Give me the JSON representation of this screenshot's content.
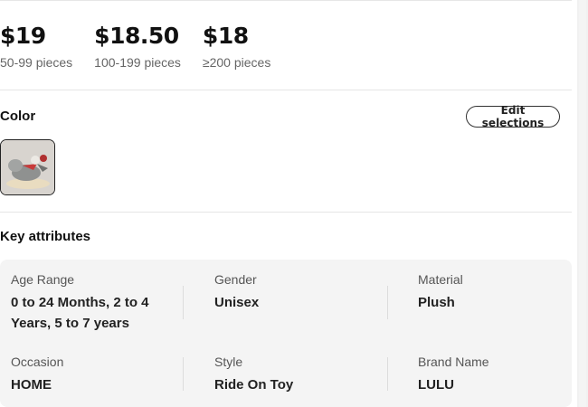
{
  "pricing": {
    "tiers": [
      {
        "price": "$19",
        "range": "50-99 pieces"
      },
      {
        "price": "$18.50",
        "range": "100-199 pieces"
      },
      {
        "price": "$18",
        "range": "≥200 pieces"
      }
    ]
  },
  "color": {
    "label": "Color",
    "edit_button": "Edit selections"
  },
  "key_attributes": {
    "title": "Key attributes",
    "items": [
      {
        "label": "Age Range",
        "value": "0 to 24 Months, 2 to 4 Years, 5 to 7 years"
      },
      {
        "label": "Gender",
        "value": "Unisex"
      },
      {
        "label": "Material",
        "value": "Plush"
      },
      {
        "label": "Occasion",
        "value": "HOME"
      },
      {
        "label": "Style",
        "value": "Ride On Toy"
      },
      {
        "label": "Brand Name",
        "value": "LULU"
      }
    ]
  }
}
